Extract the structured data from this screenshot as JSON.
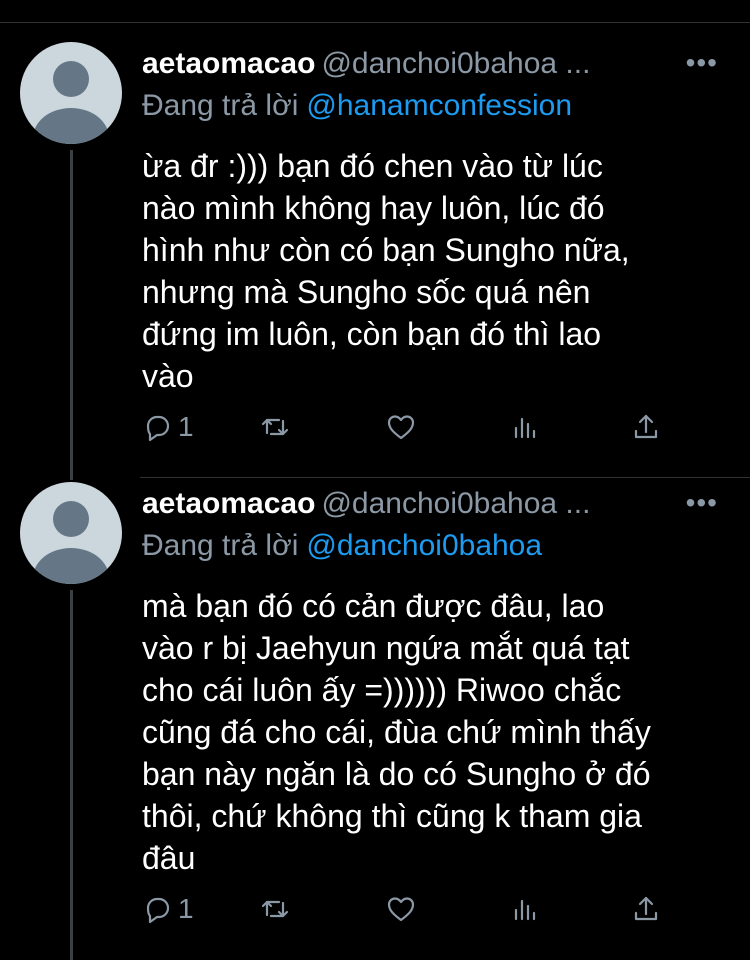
{
  "tweets": [
    {
      "display_name": "aetaomacao",
      "handle": "@danchoi0bahoa ...",
      "more_label": "•••",
      "reply_prefix": "Đang trả lời",
      "reply_to": "@hanamconfession",
      "text": "ừa đr :))) bạn đó chen vào từ lúc\nnào mình không hay luôn, lúc đó\nhình như còn có bạn Sungho nữa,\nnhưng mà Sungho sốc quá nên\nđứng im luôn, còn bạn đó thì lao\nvào",
      "reply_count": "1",
      "icons": [
        "reply-icon",
        "retweet-icon",
        "like-icon",
        "analytics-icon",
        "share-icon"
      ]
    },
    {
      "display_name": "aetaomacao",
      "handle": "@danchoi0bahoa ...",
      "more_label": "•••",
      "reply_prefix": "Đang trả lời",
      "reply_to": "@danchoi0bahoa",
      "text": "mà bạn đó có cản được đâu, lao\nvào r bị Jaehyun ngứa mắt quá tạt\ncho cái luôn ấy =)))))) Riwoo chắc\ncũng đá cho cái, đùa chứ mình thấy\nbạn này ngăn là do có Sungho ở đó\nthôi, chứ không thì cũng k tham gia\nđâu",
      "reply_count": "1",
      "icons": [
        "reply-icon",
        "retweet-icon",
        "like-icon",
        "analytics-icon",
        "share-icon"
      ]
    }
  ],
  "colors": {
    "background": "#000000",
    "text": "#ffffff",
    "secondary": "#8b98a5",
    "link": "#1d9bf0",
    "divider": "#2f3336"
  }
}
